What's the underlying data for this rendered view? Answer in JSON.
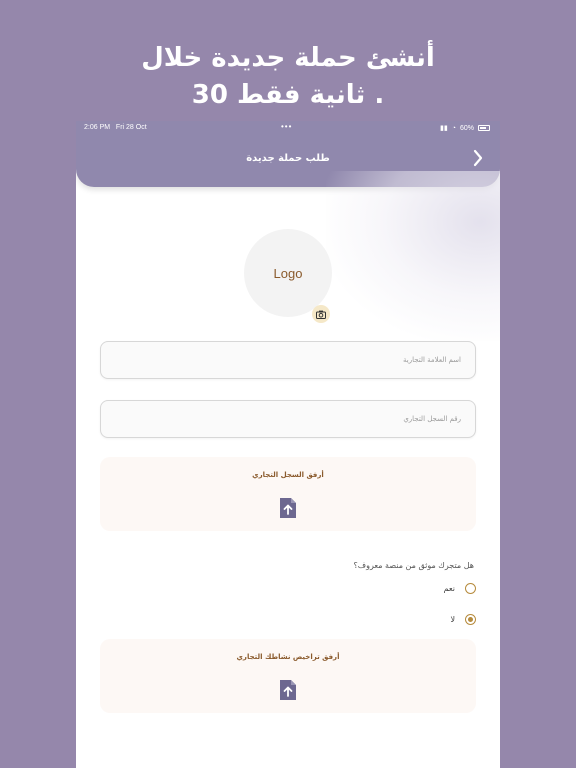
{
  "headline": {
    "line1": "أنشئ حملة جديدة خلال",
    "line2": "30 ثانية فقط ."
  },
  "status_bar": {
    "time": "2:06 PM",
    "date": "Fri 28 Oct",
    "dots": "•••",
    "battery": "60%"
  },
  "nav": {
    "title": "طلب حملة جديدة",
    "back_icon": "chevron-right-icon"
  },
  "logo": {
    "text": "Logo",
    "camera_icon": "camera-icon"
  },
  "form": {
    "brand_name_placeholder": "اسم العلامة التجارية",
    "commercial_register_placeholder": "رقم السجل التجاري",
    "attach_register_label": "أرفق السجل التجاري",
    "verified_question": "هل متجرك موثق من منصة معروف؟",
    "option_yes": "نعم",
    "option_no": "لا",
    "selected_option": "no",
    "attach_licenses_label": "أرفق تراخيص نشاطك التجاري",
    "upload_icon": "file-upload-icon"
  },
  "colors": {
    "background": "#9587ab",
    "navbar": "#9088ad",
    "accent": "#b68b3d",
    "label_brown": "#8a5a2c",
    "upload_icon": "#6d6890"
  }
}
